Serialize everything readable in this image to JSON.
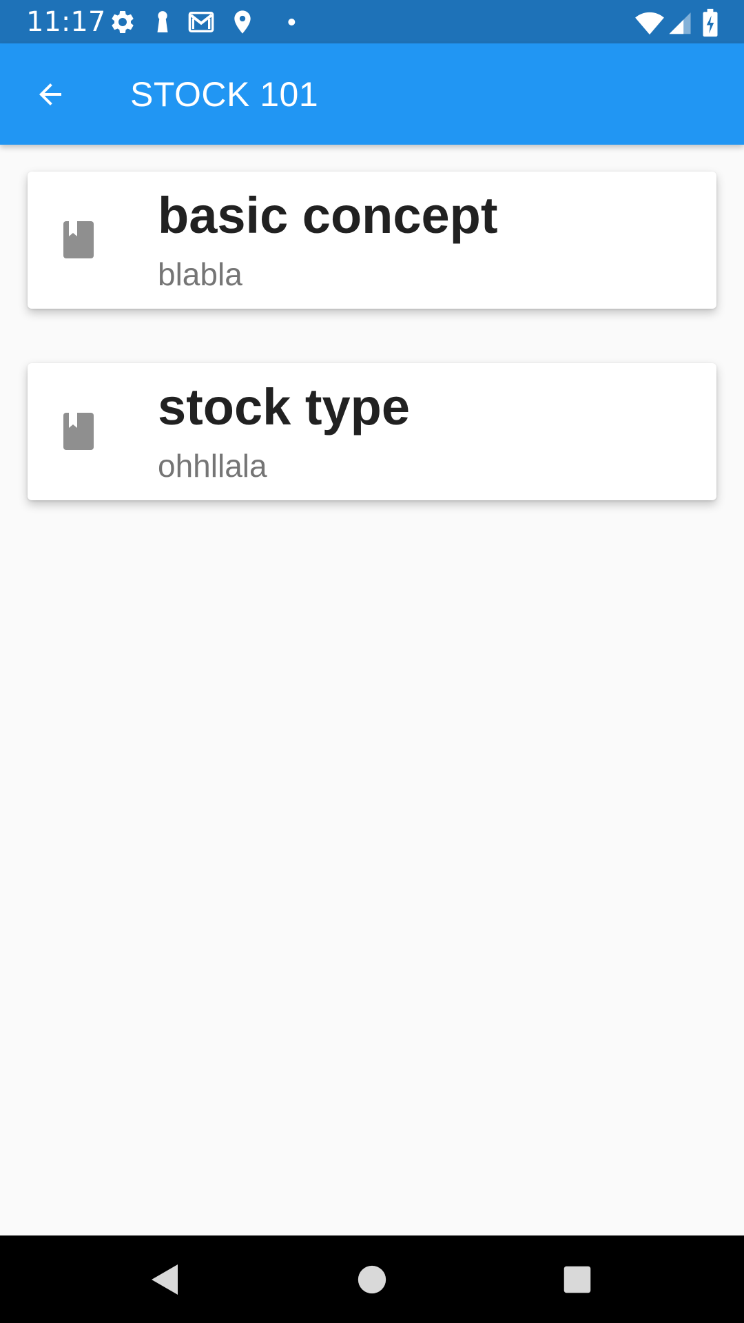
{
  "status_bar": {
    "time": "11:17",
    "left_icons": [
      "settings-icon",
      "keyhole-icon",
      "gmail-icon",
      "location-icon",
      "dot-icon"
    ],
    "right_icons": [
      "wifi-icon",
      "cell-signal-icon",
      "battery-charging-icon"
    ],
    "color": "#1e72b8"
  },
  "app_bar": {
    "title": "STOCK 101",
    "back_icon": "arrow-back-icon",
    "color": "#2196f3"
  },
  "lessons": [
    {
      "title": "basic concept",
      "subtitle": "blabla",
      "icon": "book-icon"
    },
    {
      "title": "stock type",
      "subtitle": "ohhllala",
      "icon": "book-icon"
    }
  ],
  "nav_bar": {
    "buttons": [
      "back-triangle-icon",
      "home-circle-icon",
      "recents-square-icon"
    ]
  }
}
